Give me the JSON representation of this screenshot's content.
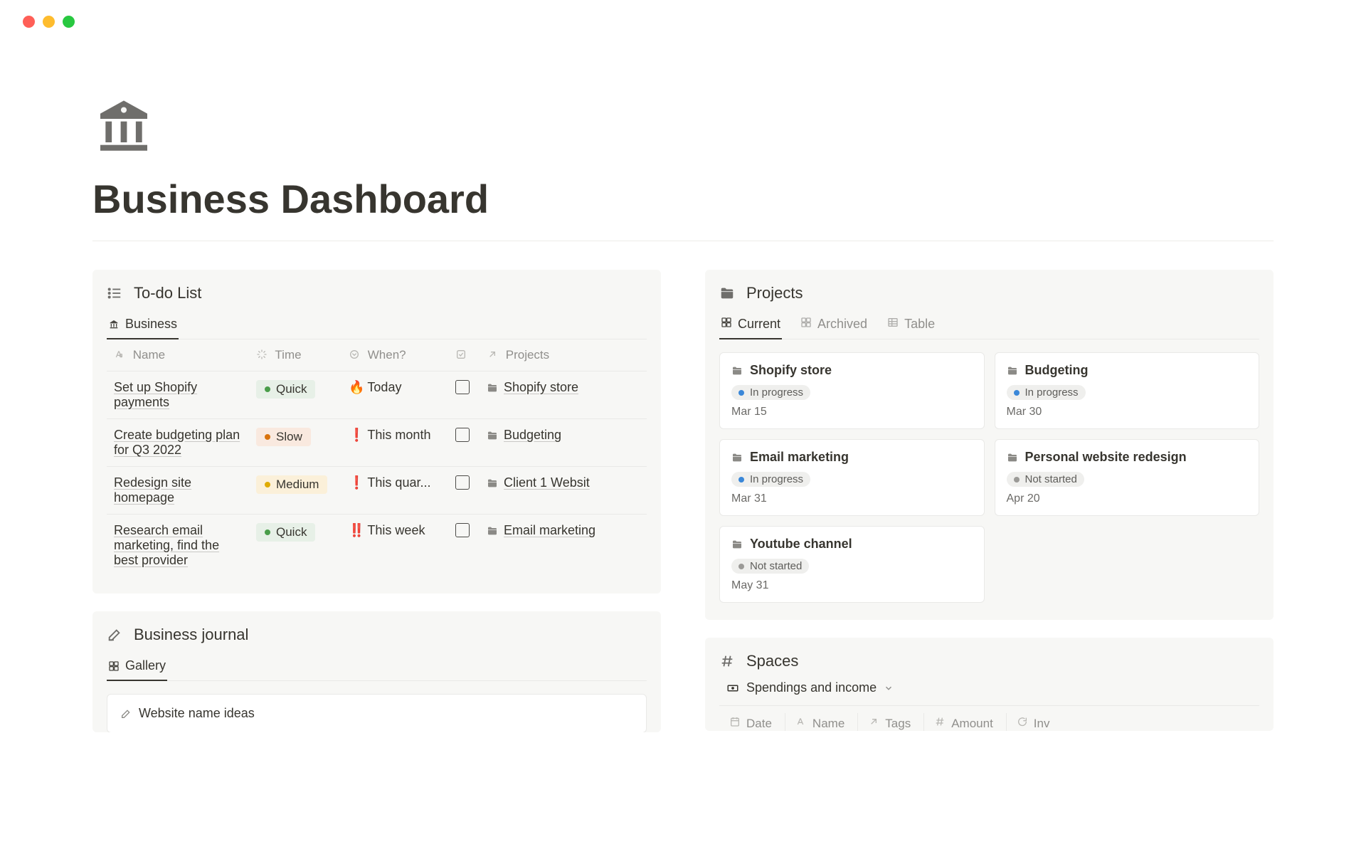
{
  "page": {
    "title": "Business Dashboard"
  },
  "todo": {
    "title": "To-do List",
    "tabs": [
      {
        "label": "Business"
      }
    ],
    "columns": {
      "name": "Name",
      "time": "Time",
      "when": "When?",
      "check": "",
      "projects": "Projects"
    },
    "rows": [
      {
        "name": "Set up Shopify payments",
        "time": "Quick",
        "timeClass": "quick",
        "whenEmoji": "🔥",
        "when": "Today",
        "project": "Shopify store"
      },
      {
        "name": "Create budgeting plan for Q3 2022",
        "time": "Slow",
        "timeClass": "slow",
        "whenEmoji": "❗",
        "when": "This month",
        "project": "Budgeting"
      },
      {
        "name": "Redesign site homepage",
        "time": "Medium",
        "timeClass": "medium",
        "whenEmoji": "❗",
        "when": "This quar...",
        "project": "Client 1 Websit"
      },
      {
        "name": "Research email marketing, find the best provider",
        "time": "Quick",
        "timeClass": "quick",
        "whenEmoji": "‼️",
        "when": "This week",
        "project": "Email marketing"
      }
    ]
  },
  "journal": {
    "title": "Business journal",
    "tabs": [
      {
        "label": "Gallery"
      }
    ],
    "item": "Website name ideas"
  },
  "projects": {
    "title": "Projects",
    "tabs": [
      {
        "label": "Current",
        "active": true,
        "icon": "board"
      },
      {
        "label": "Archived",
        "active": false,
        "icon": "board"
      },
      {
        "label": "Table",
        "active": false,
        "icon": "table"
      }
    ],
    "cards": [
      {
        "title": "Shopify store",
        "status": "In progress",
        "statusClass": "progress",
        "date": "Mar 15"
      },
      {
        "title": "Budgeting",
        "status": "In progress",
        "statusClass": "progress",
        "date": "Mar 30"
      },
      {
        "title": "Email marketing",
        "status": "In progress",
        "statusClass": "progress",
        "date": "Mar 31"
      },
      {
        "title": "Personal website redesign",
        "status": "Not started",
        "statusClass": "notstarted",
        "date": "Apr 20"
      },
      {
        "title": "Youtube channel",
        "status": "Not started",
        "statusClass": "notstarted",
        "date": "May 31"
      }
    ]
  },
  "spaces": {
    "title": "Spaces",
    "view": "Spendings and income",
    "columns": [
      "Date",
      "Name",
      "Tags",
      "Amount",
      "Inv"
    ]
  }
}
